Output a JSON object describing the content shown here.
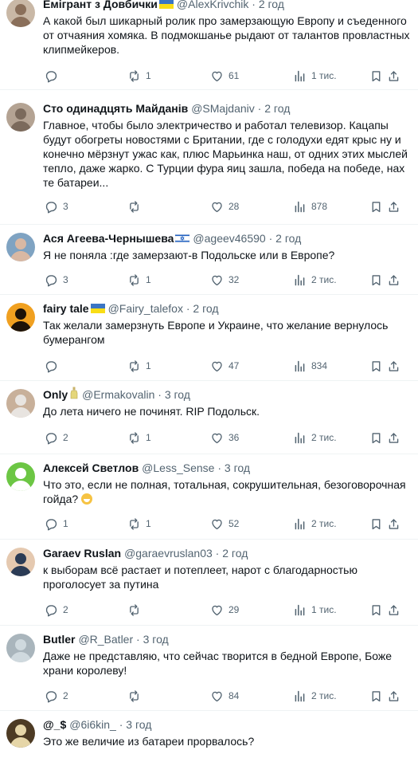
{
  "tweets": [
    {
      "name": "Емігрант з Довбички",
      "flag": "ua",
      "handle": "@AlexKrivchik",
      "time": "2 год",
      "text": "А какой был шикарный ролик про замерзающую Европу и съеденного от отчаяния хомяка. В подмокшанье рыдают от талантов провластных клипмейкеров.",
      "replies": "",
      "retweets": "1",
      "likes": "61",
      "views": "1 тис.",
      "avatar_colors": [
        "#8a6f5a",
        "#c9b8a6"
      ]
    },
    {
      "name": "Сто одинадцять Майданів",
      "flag": "",
      "handle": "@SMajdaniv",
      "time": "2 год",
      "text": "Главное, чтобы было электричество и работал телевизор. Кацапы будут обогреты новостями с Британии, где с голодухи едят крыс ну и конечно мёрзнут ужас как, плюс Марьинка наш, от одних этих мыслей тепло, даже жарко. С Турции фура яиц зашла, победа на победе, нах те батареи...",
      "replies": "3",
      "retweets": "",
      "likes": "28",
      "views": "878",
      "avatar_colors": [
        "#7b6a5c",
        "#b4a393"
      ]
    },
    {
      "name": "Ася Агеева-Чернышева",
      "flag": "il",
      "handle": "@ageev46590",
      "time": "2 год",
      "text": "Я не поняла :где замерзают-в Подольске или в Европе?",
      "replies": "3",
      "retweets": "1",
      "likes": "32",
      "views": "2 тис.",
      "avatar_colors": [
        "#d9b8a3",
        "#7fa3c2"
      ]
    },
    {
      "name": "fairy tale",
      "flag": "ua",
      "handle": "@Fairy_talefox",
      "time": "2 год",
      "text": "Так желали замерзнуть Европе и Украине, что желание вернулось бумерангом",
      "replies": "",
      "retweets": "1",
      "likes": "47",
      "views": "834",
      "avatar_colors": [
        "#1c1208",
        "#f0a020"
      ]
    },
    {
      "name": "Only",
      "flag": "bottle",
      "handle": "@Ermakovalin",
      "time": "3 год",
      "text": "До лета ничего не починят. RIP Подольск.",
      "replies": "2",
      "retweets": "1",
      "likes": "36",
      "views": "2 тис.",
      "avatar_colors": [
        "#e8e4e0",
        "#c8b09a"
      ]
    },
    {
      "name": "Алексей Светлов",
      "flag": "",
      "handle": "@Less_Sense",
      "time": "3 год",
      "text": "Что это, если не полная, тотальная, сокрушительная, безоговорочная гойда?",
      "emoji": true,
      "replies": "1",
      "retweets": "1",
      "likes": "52",
      "views": "2 тис.",
      "avatar_colors": [
        "#ffffff",
        "#6cc644"
      ]
    },
    {
      "name": "Garaev Ruslan",
      "flag": "",
      "handle": "@garaevruslan03",
      "time": "2 год",
      "text": "к выборам всё растает и потеплеет, нарот с благодарностью проголосует за путина",
      "replies": "2",
      "retweets": "",
      "likes": "29",
      "views": "1 тис.",
      "avatar_colors": [
        "#2b3b55",
        "#e5c9b0"
      ]
    },
    {
      "name": "Butler",
      "flag": "",
      "handle": "@R_Batler",
      "time": "3 год",
      "text": "Даже не представляю, что сейчас творится в бедной Европе, Боже храни королеву!",
      "replies": "2",
      "retweets": "",
      "likes": "84",
      "views": "2 тис.",
      "avatar_colors": [
        "#cfd9de",
        "#a9b5bc"
      ]
    },
    {
      "name": "@_$",
      "flag": "",
      "handle": "@6i6kin_",
      "time": "3 год",
      "text": "Это же величие из батареи прорвалось?",
      "replies": "",
      "retweets": "",
      "likes": "",
      "views": "",
      "avatar_colors": [
        "#e6d6a8",
        "#4d3b24"
      ]
    }
  ],
  "colors": {
    "text": "#0f1419",
    "secondary": "#536471",
    "divider": "#eff3f4"
  }
}
